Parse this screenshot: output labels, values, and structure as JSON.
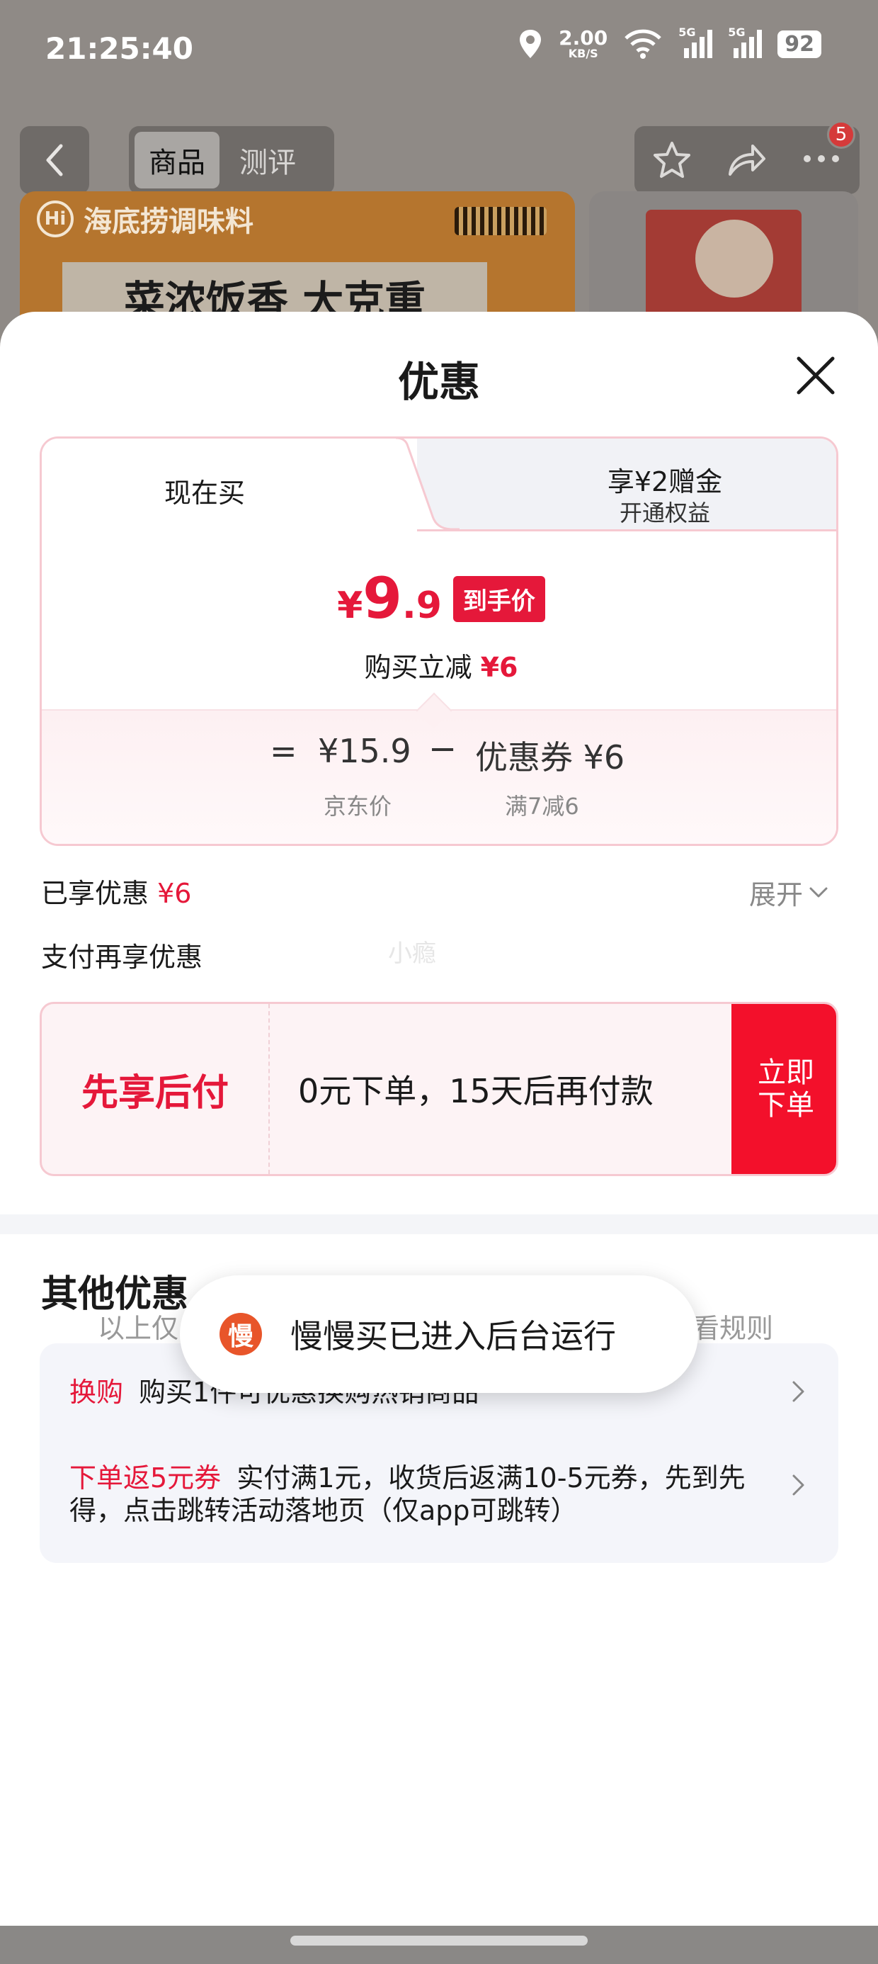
{
  "status_bar": {
    "time": "21:25:40",
    "net_speed_value": "2.00",
    "net_speed_unit": "KB/S",
    "signal1_label": "5G",
    "signal2_label": "5G",
    "battery": "92"
  },
  "nav": {
    "tabs": [
      "商品",
      "测评"
    ],
    "cart_badge": "5"
  },
  "banner": {
    "brand": "海底捞调味料",
    "headline": "菜浓饭香 大克重"
  },
  "sheet": {
    "title": "优惠"
  },
  "deal": {
    "tab_now": "现在买",
    "tab_member_title": "享¥2赠金",
    "tab_member_sub": "开通权益",
    "price_currency": "¥",
    "price_int": "9",
    "price_dec": ".9",
    "price_tag": "到手价",
    "sub_label": "购买立减",
    "sub_value": "¥6",
    "calc_eq": "=",
    "calc_jd_price": "¥15.9",
    "calc_minus": "−",
    "calc_coupon": "优惠券 ¥6",
    "calc_jd_label": "京东价",
    "calc_coupon_label": "满7减6"
  },
  "enjoyed": {
    "label": "已享优惠",
    "value": "¥6",
    "expand": "展开"
  },
  "pay_more": "支付再享优惠",
  "watermark": "小瘾",
  "bnpl": {
    "title": "先享后付",
    "desc": "0元下单，15天后再付款",
    "btn_line1": "立即",
    "btn_line2": "下单"
  },
  "other": {
    "title": "其他优惠",
    "item1_tag": "换购",
    "item1_text": "购买1件可优惠换购热销商品",
    "item2_tag": "下单返5元券",
    "item2_text": "实付满1元，收货后返满10-5元券，先到先得，点击跳转活动落地页（仅app可跳转）"
  },
  "footer": {
    "left": "以上仅",
    "right": "看规则"
  },
  "toast": {
    "icon_char": "慢",
    "text": "慢慢买已进入后台运行"
  },
  "colors": {
    "accent_red": "#e5183a",
    "button_red": "#f3102b",
    "card_border": "#f6c9d1"
  }
}
